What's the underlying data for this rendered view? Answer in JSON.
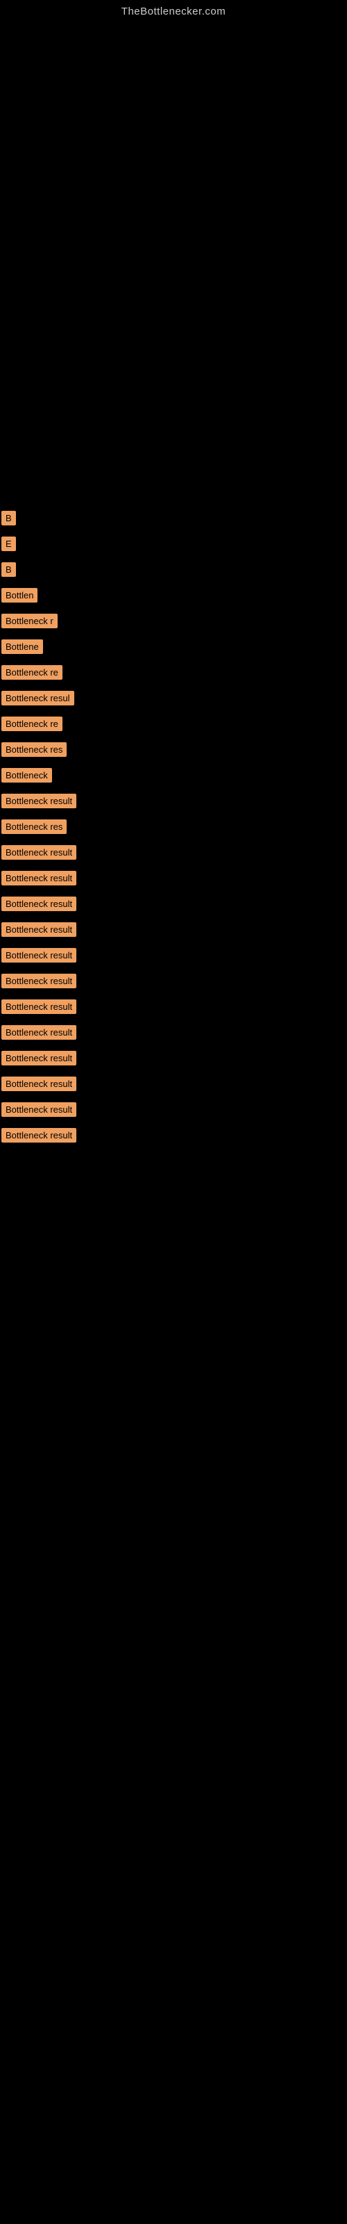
{
  "site": {
    "title": "TheBottlenecker.com"
  },
  "labels": {
    "bottleneck_result": "Bottleneck result"
  },
  "rows": [
    {
      "id": 1,
      "text": "B",
      "width": "w-small"
    },
    {
      "id": 2,
      "text": "E",
      "width": "w-small"
    },
    {
      "id": 3,
      "text": "B",
      "width": "w-small"
    },
    {
      "id": 4,
      "text": "Bottlen",
      "width": "w-med"
    },
    {
      "id": 5,
      "text": "Bottleneck r",
      "width": "w-med-large"
    },
    {
      "id": 6,
      "text": "Bottlene",
      "width": "w-med"
    },
    {
      "id": 7,
      "text": "Bottleneck re",
      "width": "w-large"
    },
    {
      "id": 8,
      "text": "Bottleneck resul",
      "width": "w-full"
    },
    {
      "id": 9,
      "text": "Bottleneck re",
      "width": "w-large"
    },
    {
      "id": 10,
      "text": "Bottleneck res",
      "width": "w-full"
    },
    {
      "id": 11,
      "text": "Bottleneck",
      "width": "w-med-large"
    },
    {
      "id": 12,
      "text": "Bottleneck result",
      "width": "w-full"
    },
    {
      "id": 13,
      "text": "Bottleneck res",
      "width": "w-full"
    },
    {
      "id": 14,
      "text": "Bottleneck result",
      "width": "w-full"
    },
    {
      "id": 15,
      "text": "Bottleneck result",
      "width": "w-full"
    },
    {
      "id": 16,
      "text": "Bottleneck result",
      "width": "w-full"
    },
    {
      "id": 17,
      "text": "Bottleneck result",
      "width": "w-full"
    },
    {
      "id": 18,
      "text": "Bottleneck result",
      "width": "w-full"
    },
    {
      "id": 19,
      "text": "Bottleneck result",
      "width": "w-full"
    },
    {
      "id": 20,
      "text": "Bottleneck result",
      "width": "w-full"
    },
    {
      "id": 21,
      "text": "Bottleneck result",
      "width": "w-full"
    },
    {
      "id": 22,
      "text": "Bottleneck result",
      "width": "w-full"
    },
    {
      "id": 23,
      "text": "Bottleneck result",
      "width": "w-full"
    },
    {
      "id": 24,
      "text": "Bottleneck result",
      "width": "w-full"
    },
    {
      "id": 25,
      "text": "Bottleneck result",
      "width": "w-full"
    }
  ]
}
